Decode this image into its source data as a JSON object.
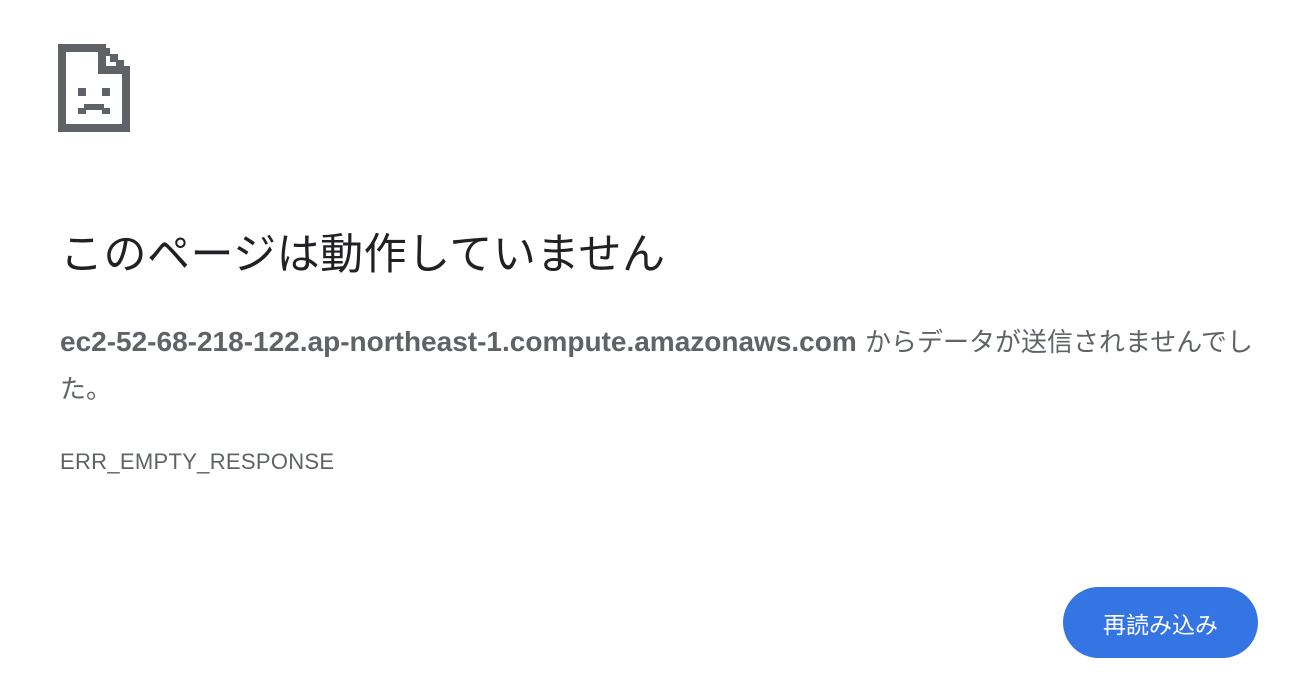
{
  "error_page": {
    "icon": "sad-page-icon",
    "title": "このページは動作していません",
    "message_host": "ec2-52-68-218-122.ap-northeast-1.compute.amazonaws.com",
    "message_suffix": " からデータが送信されませんでした。",
    "error_code": "ERR_EMPTY_RESPONSE",
    "reload_label": "再読み込み"
  },
  "colors": {
    "title_text": "#202124",
    "body_text": "#5f6368",
    "button_bg": "#3574e3",
    "button_text": "#ffffff",
    "icon": "#5f6368"
  }
}
